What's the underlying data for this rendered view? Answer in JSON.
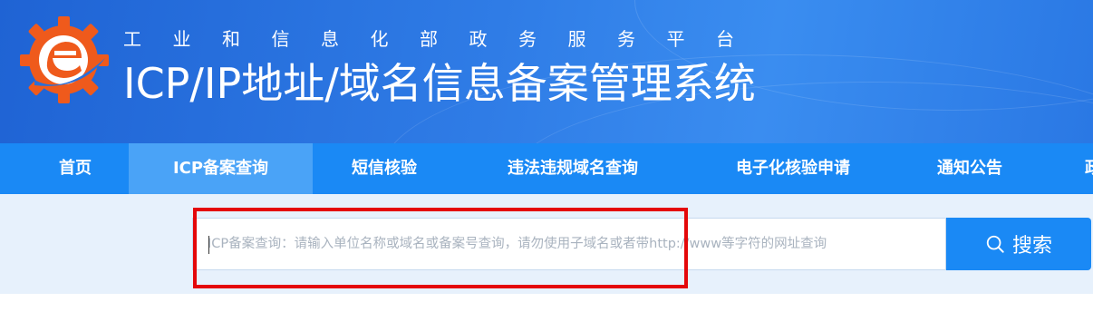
{
  "header": {
    "subtitle": "工业和信息化部政务服务平台",
    "title": "ICP/IP地址/域名信息备案管理系统",
    "logo_icon": "gear-e-logo-icon"
  },
  "nav": {
    "items": [
      {
        "label": "首页"
      },
      {
        "label": "ICP备案查询",
        "active": true
      },
      {
        "label": "短信核验"
      },
      {
        "label": "违法违规域名查询"
      },
      {
        "label": "电子化核验申请"
      },
      {
        "label": "通知公告"
      },
      {
        "label": "政"
      }
    ]
  },
  "search": {
    "placeholder": "ICP备案查询：请输入单位名称或域名或备案号查询，请勿使用子域名或者带http://www等字符的网址查询",
    "value": "",
    "button_label": "搜索",
    "button_icon": "search-icon"
  },
  "colors": {
    "header_blue": "#2f7ce6",
    "nav_blue": "#1a89f5",
    "nav_active": "#4aa3f7",
    "search_bg": "#e7f1fc",
    "highlight_red": "#e4080a",
    "logo_orange": "#ef5a1c"
  }
}
